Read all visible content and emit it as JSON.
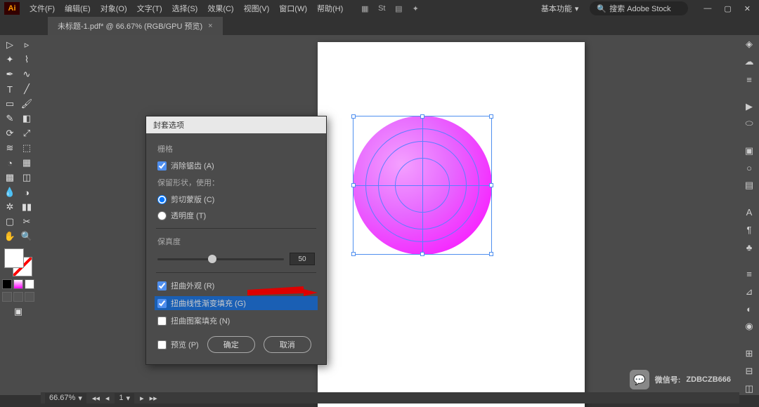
{
  "app": {
    "logo": "Ai"
  },
  "menu": {
    "file": "文件(F)",
    "edit": "编辑(E)",
    "object": "对象(O)",
    "type": "文字(T)",
    "select": "选择(S)",
    "effect": "效果(C)",
    "view": "视图(V)",
    "window": "窗口(W)",
    "help": "帮助(H)"
  },
  "workspace": {
    "label": "基本功能",
    "search_placeholder": "搜索 Adobe Stock"
  },
  "tab": {
    "title": "未标题-1.pdf* @ 66.67% (RGB/GPU 预览)"
  },
  "dialog": {
    "title": "封套选项",
    "sec_grid": "栅格",
    "antialias": "消除锯齿 (A)",
    "preserve_shape": "保留形状，使用：",
    "clip_mask": "剪切蒙版 (C)",
    "transparency": "透明度 (T)",
    "fidelity": "保真度",
    "fidelity_val": "50",
    "distort_appearance": "扭曲外观 (R)",
    "distort_linear_gradient": "扭曲线性渐变填充 (G)",
    "distort_pattern_fill": "扭曲图案填充 (N)",
    "preview": "预览 (P)",
    "ok": "确定",
    "cancel": "取消"
  },
  "status": {
    "zoom": "66.67%",
    "page_nav": "1"
  },
  "watermark": {
    "label": "微信号:",
    "id": "ZDBCZB666"
  }
}
